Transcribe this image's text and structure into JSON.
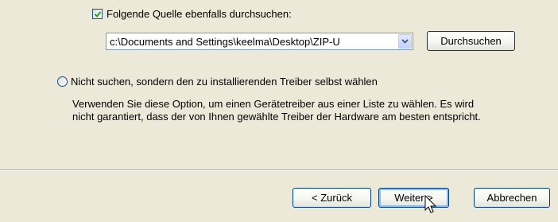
{
  "search_option": {
    "checkbox_label": "Folgende Quelle ebenfalls durchsuchen:",
    "checked": true,
    "path_value": "c:\\Documents and Settings\\keelma\\Desktop\\ZIP-U",
    "browse_label": "Durchsuchen"
  },
  "manual_option": {
    "radio_label": "Nicht suchen, sondern den zu installierenden Treiber selbst wählen",
    "selected": false,
    "description_line1": "Verwenden Sie diese Option, um einen Gerätetreiber aus einer Liste zu wählen. Es wird",
    "description_line2": "nicht garantiert, dass der von Ihnen gewählte Treiber der Hardware am besten entspricht."
  },
  "footer": {
    "back_label": "< Zurück",
    "next_label": "Weiter >",
    "cancel_label": "Abbrechen"
  },
  "icons": {
    "checkmark": "check-icon",
    "combo_arrow": "chevron-down-icon",
    "cursor": "hand-pointer-icon"
  },
  "colors": {
    "panel_bg": "#ece9d8",
    "button_border": "#003c74",
    "field_border": "#7f9db9",
    "checkbox_check": "#21a121"
  }
}
